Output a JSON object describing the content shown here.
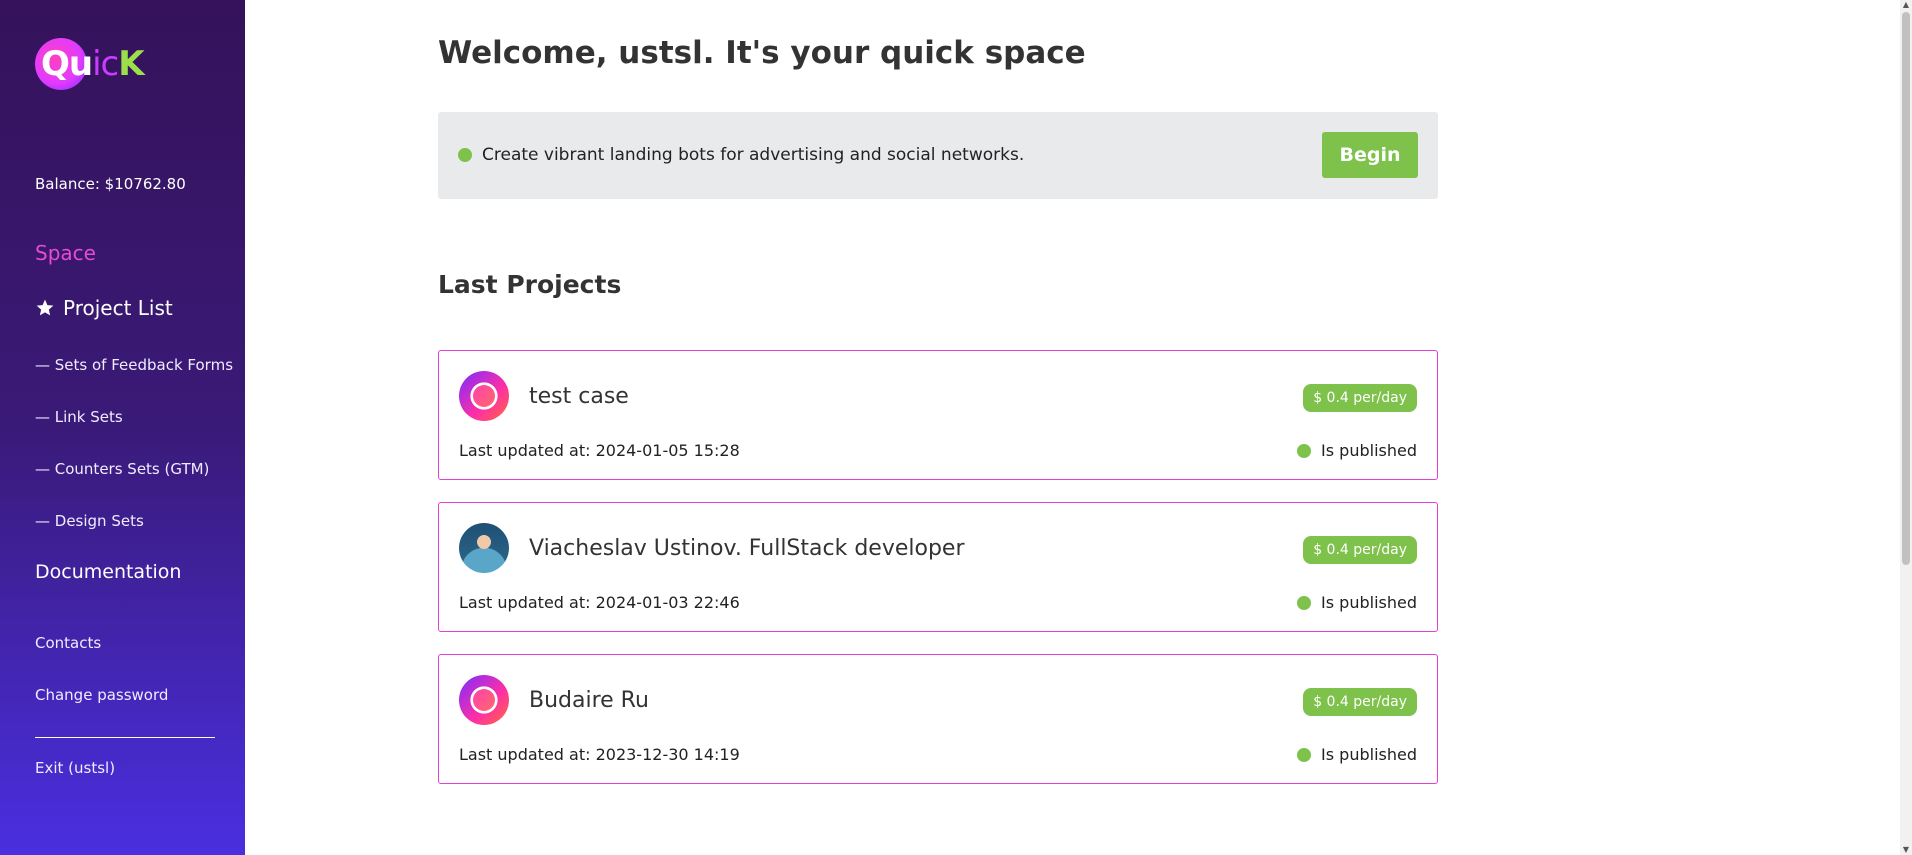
{
  "logo": {
    "part1": "Qu",
    "part2": "ic",
    "part3": "K"
  },
  "sidebar": {
    "balance": "Balance: $10762.80",
    "space": "Space",
    "project_list": "Project List",
    "sub_items": [
      "— Sets of Feedback Forms",
      "— Link Sets",
      "— Counters Sets (GTM)",
      "— Design Sets"
    ],
    "documentation": "Documentation",
    "contacts": "Contacts",
    "change_password": "Change password",
    "exit": "Exit (ustsl)"
  },
  "main": {
    "title": "Welcome, ustsl. It's your quick space",
    "banner": {
      "text": "Create vibrant landing bots for advertising and social networks.",
      "button": "Begin"
    },
    "section_title": "Last Projects",
    "projects": [
      {
        "name": "test case",
        "price": "$ 0.4 per/day",
        "updated": "Last updated at: 2024-01-05 15:28",
        "status": "Is published",
        "avatar": "quick-logo"
      },
      {
        "name": "Viacheslav Ustinov. FullStack developer",
        "price": "$ 0.4 per/day",
        "updated": "Last updated at: 2024-01-03 22:46",
        "status": "Is published",
        "avatar": "user-photo"
      },
      {
        "name": "Budaire Ru",
        "price": "$ 0.4 per/day",
        "updated": "Last updated at: 2023-12-30 14:19",
        "status": "Is published",
        "avatar": "quick-logo"
      }
    ]
  },
  "colors": {
    "accent_green": "#7ec14b",
    "accent_pink": "#e43fd8",
    "sidebar_top": "#35125a",
    "sidebar_bottom": "#4a2fe0"
  },
  "icons": {
    "project_list": "star-icon",
    "status": "status-dot-icon"
  }
}
